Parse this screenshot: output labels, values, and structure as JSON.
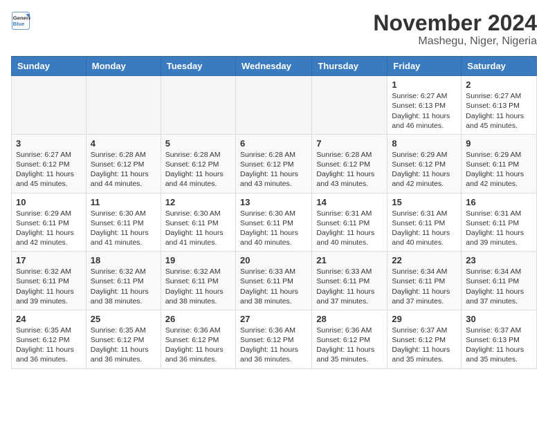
{
  "header": {
    "logo": {
      "line1": "General",
      "line2": "Blue"
    },
    "title": "November 2024",
    "subtitle": "Mashegu, Niger, Nigeria"
  },
  "weekdays": [
    "Sunday",
    "Monday",
    "Tuesday",
    "Wednesday",
    "Thursday",
    "Friday",
    "Saturday"
  ],
  "weeks": [
    [
      {
        "day": "",
        "empty": true
      },
      {
        "day": "",
        "empty": true
      },
      {
        "day": "",
        "empty": true
      },
      {
        "day": "",
        "empty": true
      },
      {
        "day": "",
        "empty": true
      },
      {
        "day": "1",
        "sunrise": "Sunrise: 6:27 AM",
        "sunset": "Sunset: 6:13 PM",
        "daylight": "Daylight: 11 hours and 46 minutes."
      },
      {
        "day": "2",
        "sunrise": "Sunrise: 6:27 AM",
        "sunset": "Sunset: 6:13 PM",
        "daylight": "Daylight: 11 hours and 45 minutes."
      }
    ],
    [
      {
        "day": "3",
        "sunrise": "Sunrise: 6:27 AM",
        "sunset": "Sunset: 6:12 PM",
        "daylight": "Daylight: 11 hours and 45 minutes."
      },
      {
        "day": "4",
        "sunrise": "Sunrise: 6:28 AM",
        "sunset": "Sunset: 6:12 PM",
        "daylight": "Daylight: 11 hours and 44 minutes."
      },
      {
        "day": "5",
        "sunrise": "Sunrise: 6:28 AM",
        "sunset": "Sunset: 6:12 PM",
        "daylight": "Daylight: 11 hours and 44 minutes."
      },
      {
        "day": "6",
        "sunrise": "Sunrise: 6:28 AM",
        "sunset": "Sunset: 6:12 PM",
        "daylight": "Daylight: 11 hours and 43 minutes."
      },
      {
        "day": "7",
        "sunrise": "Sunrise: 6:28 AM",
        "sunset": "Sunset: 6:12 PM",
        "daylight": "Daylight: 11 hours and 43 minutes."
      },
      {
        "day": "8",
        "sunrise": "Sunrise: 6:29 AM",
        "sunset": "Sunset: 6:12 PM",
        "daylight": "Daylight: 11 hours and 42 minutes."
      },
      {
        "day": "9",
        "sunrise": "Sunrise: 6:29 AM",
        "sunset": "Sunset: 6:11 PM",
        "daylight": "Daylight: 11 hours and 42 minutes."
      }
    ],
    [
      {
        "day": "10",
        "sunrise": "Sunrise: 6:29 AM",
        "sunset": "Sunset: 6:11 PM",
        "daylight": "Daylight: 11 hours and 42 minutes."
      },
      {
        "day": "11",
        "sunrise": "Sunrise: 6:30 AM",
        "sunset": "Sunset: 6:11 PM",
        "daylight": "Daylight: 11 hours and 41 minutes."
      },
      {
        "day": "12",
        "sunrise": "Sunrise: 6:30 AM",
        "sunset": "Sunset: 6:11 PM",
        "daylight": "Daylight: 11 hours and 41 minutes."
      },
      {
        "day": "13",
        "sunrise": "Sunrise: 6:30 AM",
        "sunset": "Sunset: 6:11 PM",
        "daylight": "Daylight: 11 hours and 40 minutes."
      },
      {
        "day": "14",
        "sunrise": "Sunrise: 6:31 AM",
        "sunset": "Sunset: 6:11 PM",
        "daylight": "Daylight: 11 hours and 40 minutes."
      },
      {
        "day": "15",
        "sunrise": "Sunrise: 6:31 AM",
        "sunset": "Sunset: 6:11 PM",
        "daylight": "Daylight: 11 hours and 40 minutes."
      },
      {
        "day": "16",
        "sunrise": "Sunrise: 6:31 AM",
        "sunset": "Sunset: 6:11 PM",
        "daylight": "Daylight: 11 hours and 39 minutes."
      }
    ],
    [
      {
        "day": "17",
        "sunrise": "Sunrise: 6:32 AM",
        "sunset": "Sunset: 6:11 PM",
        "daylight": "Daylight: 11 hours and 39 minutes."
      },
      {
        "day": "18",
        "sunrise": "Sunrise: 6:32 AM",
        "sunset": "Sunset: 6:11 PM",
        "daylight": "Daylight: 11 hours and 38 minutes."
      },
      {
        "day": "19",
        "sunrise": "Sunrise: 6:32 AM",
        "sunset": "Sunset: 6:11 PM",
        "daylight": "Daylight: 11 hours and 38 minutes."
      },
      {
        "day": "20",
        "sunrise": "Sunrise: 6:33 AM",
        "sunset": "Sunset: 6:11 PM",
        "daylight": "Daylight: 11 hours and 38 minutes."
      },
      {
        "day": "21",
        "sunrise": "Sunrise: 6:33 AM",
        "sunset": "Sunset: 6:11 PM",
        "daylight": "Daylight: 11 hours and 37 minutes."
      },
      {
        "day": "22",
        "sunrise": "Sunrise: 6:34 AM",
        "sunset": "Sunset: 6:11 PM",
        "daylight": "Daylight: 11 hours and 37 minutes."
      },
      {
        "day": "23",
        "sunrise": "Sunrise: 6:34 AM",
        "sunset": "Sunset: 6:11 PM",
        "daylight": "Daylight: 11 hours and 37 minutes."
      }
    ],
    [
      {
        "day": "24",
        "sunrise": "Sunrise: 6:35 AM",
        "sunset": "Sunset: 6:12 PM",
        "daylight": "Daylight: 11 hours and 36 minutes."
      },
      {
        "day": "25",
        "sunrise": "Sunrise: 6:35 AM",
        "sunset": "Sunset: 6:12 PM",
        "daylight": "Daylight: 11 hours and 36 minutes."
      },
      {
        "day": "26",
        "sunrise": "Sunrise: 6:36 AM",
        "sunset": "Sunset: 6:12 PM",
        "daylight": "Daylight: 11 hours and 36 minutes."
      },
      {
        "day": "27",
        "sunrise": "Sunrise: 6:36 AM",
        "sunset": "Sunset: 6:12 PM",
        "daylight": "Daylight: 11 hours and 36 minutes."
      },
      {
        "day": "28",
        "sunrise": "Sunrise: 6:36 AM",
        "sunset": "Sunset: 6:12 PM",
        "daylight": "Daylight: 11 hours and 35 minutes."
      },
      {
        "day": "29",
        "sunrise": "Sunrise: 6:37 AM",
        "sunset": "Sunset: 6:12 PM",
        "daylight": "Daylight: 11 hours and 35 minutes."
      },
      {
        "day": "30",
        "sunrise": "Sunrise: 6:37 AM",
        "sunset": "Sunset: 6:13 PM",
        "daylight": "Daylight: 11 hours and 35 minutes."
      }
    ]
  ]
}
